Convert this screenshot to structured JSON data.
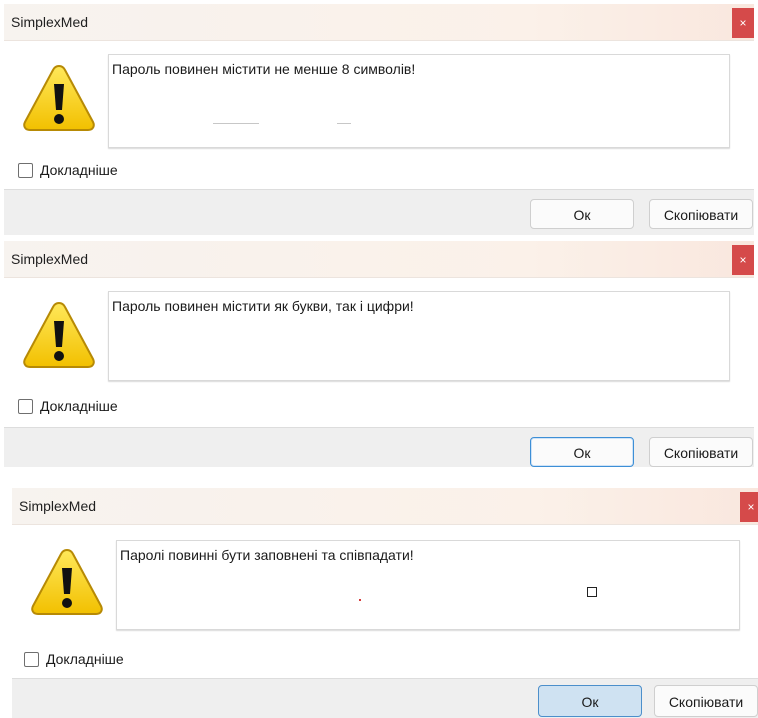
{
  "colors": {
    "close_button": "#d54a4a",
    "warning_fill": "#f6d00d",
    "warning_border": "#b78a05",
    "default_button_border": "#4c8fcb"
  },
  "dialogs": [
    {
      "title": "SimplexMed",
      "close_label": "×",
      "icon": "warning-icon",
      "message": "Пароль повинен містити не менше 8 символів!",
      "details_label": "Докладніше",
      "ok_label": "Ок",
      "copy_label": "Скопіювати"
    },
    {
      "title": "SimplexMed",
      "close_label": "×",
      "icon": "warning-icon",
      "message": "Пароль повинен містити як букви, так і цифри!",
      "details_label": "Докладніше",
      "ok_label": "Ок",
      "copy_label": "Скопіювати"
    },
    {
      "title": "SimplexMed",
      "close_label": "×",
      "icon": "warning-icon",
      "message": "Паролі повинні бути заповнені та співпадати!",
      "details_label": "Докладніше",
      "ok_label": "Ок",
      "copy_label": "Скопіювати"
    }
  ]
}
